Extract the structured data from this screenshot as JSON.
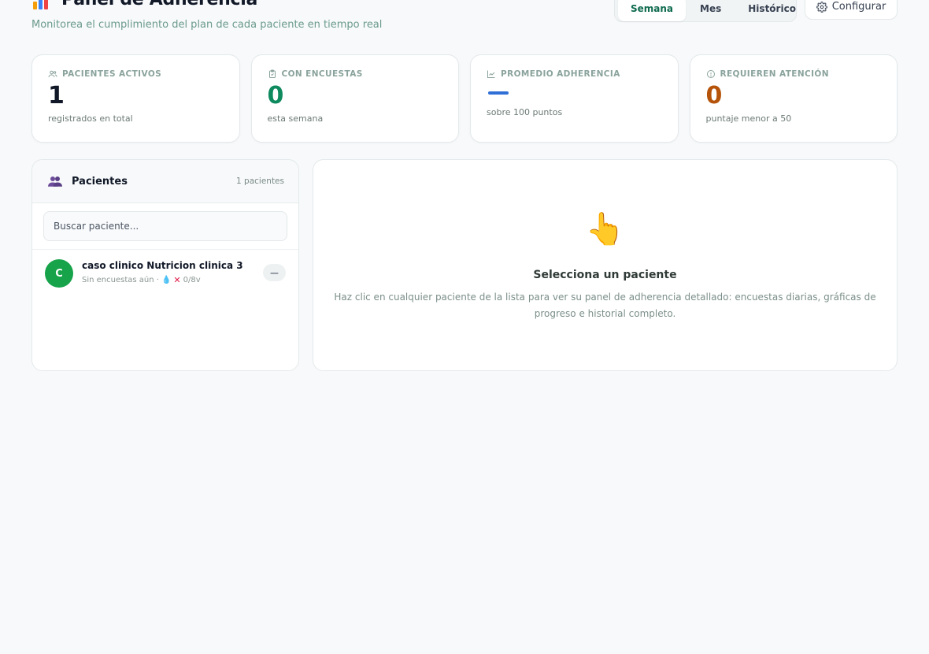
{
  "header": {
    "title": "Panel de Adherencia",
    "subtitle": "Monitorea el cumplimiento del plan de cada paciente en tiempo real",
    "range_options": [
      "Semana",
      "Mes",
      "Histórico"
    ],
    "range_selected": "Semana",
    "config_label": "Configurar"
  },
  "stats": [
    {
      "label": "PACIENTES ACTIVOS",
      "value": "1",
      "sub": "registrados en total",
      "icon": "users-icon"
    },
    {
      "label": "CON ENCUESTAS",
      "value": "0",
      "sub": "esta semana",
      "icon": "clipboard-icon"
    },
    {
      "label": "PROMEDIO ADHERENCIA",
      "value": "—",
      "sub": "sobre 100 puntos",
      "icon": "chart-line-icon"
    },
    {
      "label": "REQUIEREN ATENCIÓN",
      "value": "0",
      "sub": "puntaje menor a 50",
      "icon": "alert-circle-icon"
    }
  ],
  "patients_panel": {
    "title": "Pacientes",
    "count": "1 pacientes",
    "search_placeholder": "Buscar paciente...",
    "items": [
      {
        "initial": "C",
        "name": "caso clinico Nutricion clinica 3",
        "meta": "Sin encuestas aún ·",
        "water": "0/8v",
        "score": "—"
      }
    ]
  },
  "detail": {
    "title": "Selecciona un paciente",
    "text": "Haz clic en cualquier paciente de la lista para ver su panel de adherencia detallado: encuestas diarias, gráficas de progreso e historial completo."
  },
  "colors": {
    "accent_green": "#0f8a5f",
    "avatar_green": "#16a34a",
    "attention_amber": "#b45309",
    "average_blue": "#2f6fd6"
  }
}
